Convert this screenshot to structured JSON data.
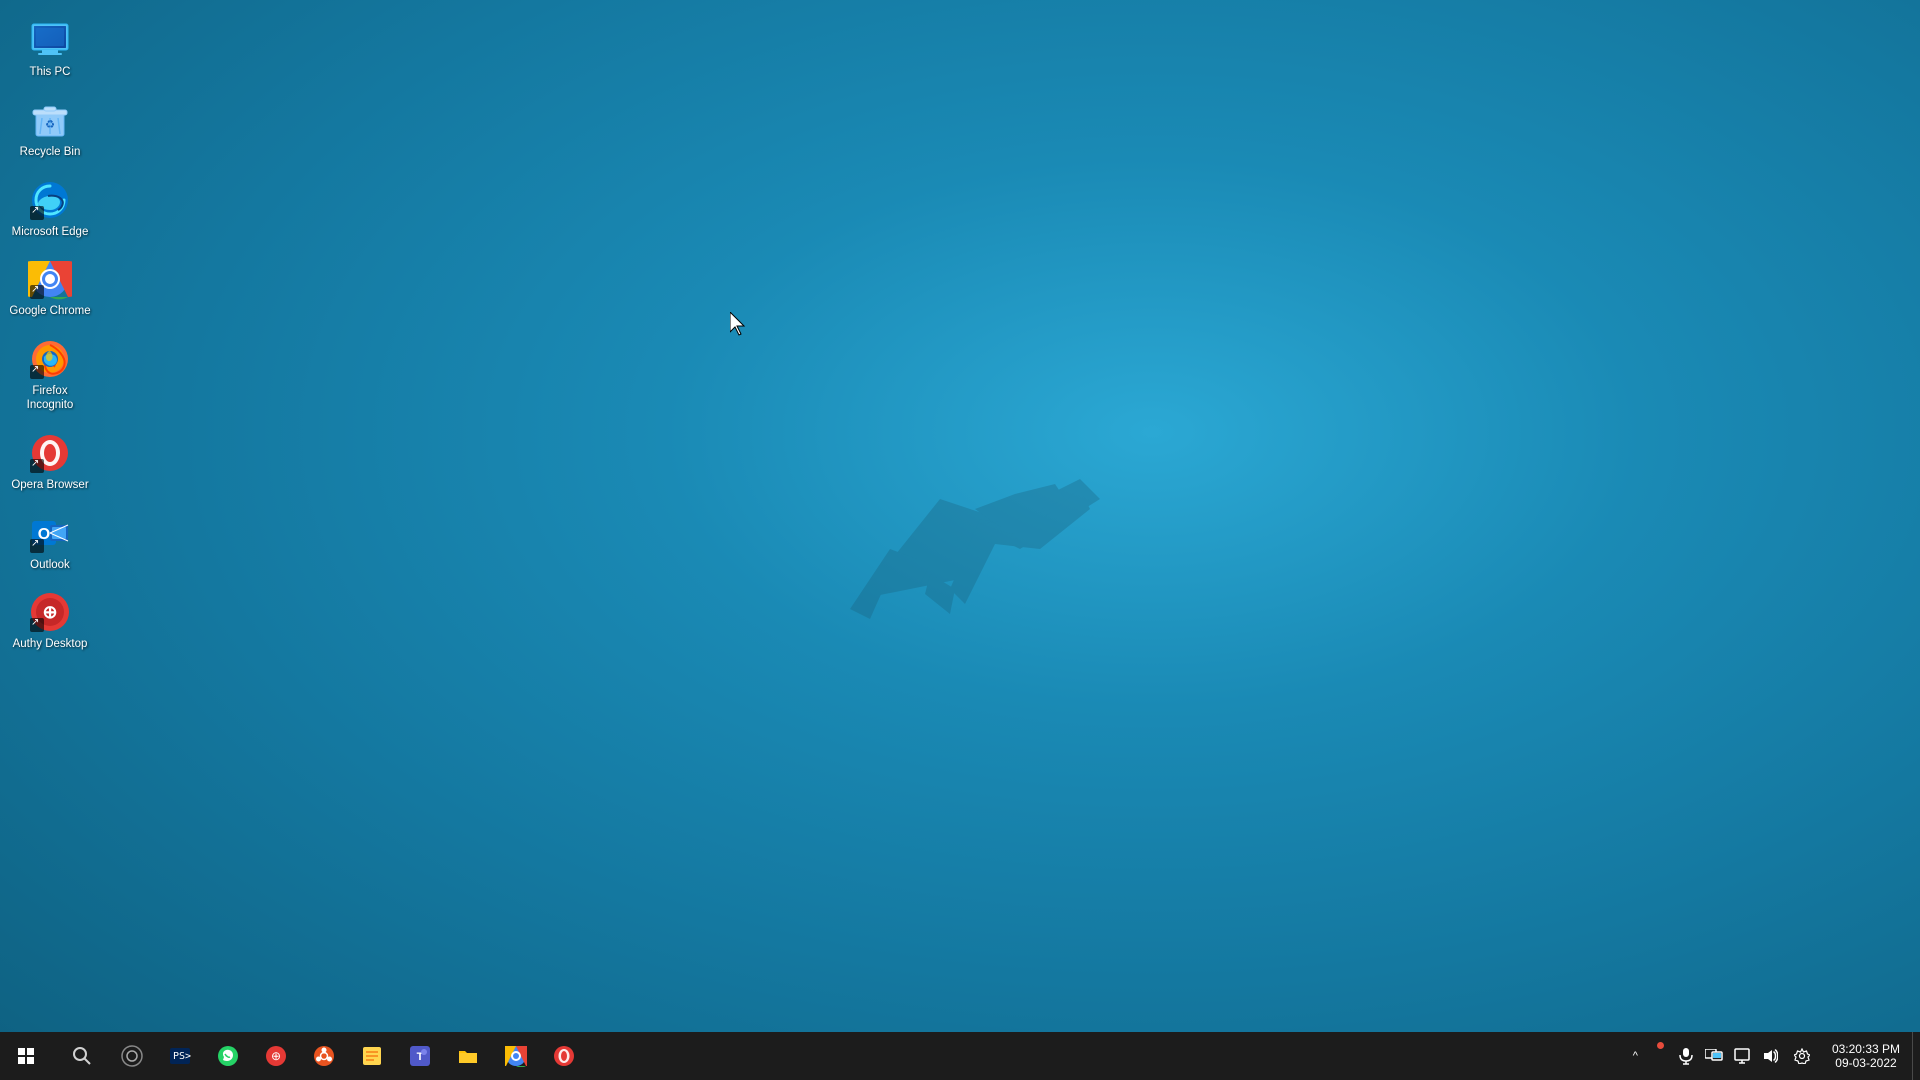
{
  "desktop": {
    "background_color_start": "#2ba8d4",
    "background_color_end": "#0e6080"
  },
  "icons": [
    {
      "id": "this-pc",
      "label": "This PC",
      "shortcut": false,
      "color": "#4fc3f7"
    },
    {
      "id": "recycle-bin",
      "label": "Recycle Bin",
      "shortcut": false,
      "color": "#90caf9"
    },
    {
      "id": "microsoft-edge",
      "label": "Microsoft Edge",
      "shortcut": true,
      "color": "#0078d4"
    },
    {
      "id": "google-chrome",
      "label": "Google Chrome",
      "shortcut": true,
      "color": "#4caf50"
    },
    {
      "id": "firefox-incognito",
      "label": "Firefox Incognito",
      "shortcut": true,
      "color": "#ff6b35"
    },
    {
      "id": "opera-browser",
      "label": "Opera Browser",
      "shortcut": true,
      "color": "#e53935"
    },
    {
      "id": "outlook",
      "label": "Outlook",
      "shortcut": true,
      "color": "#0078d4"
    },
    {
      "id": "authy-desktop",
      "label": "Authy Desktop",
      "shortcut": true,
      "color": "#e53935"
    }
  ],
  "taskbar": {
    "items": [
      {
        "id": "start",
        "label": "Start"
      },
      {
        "id": "search",
        "label": "Search"
      },
      {
        "id": "cortana",
        "label": "Cortana"
      },
      {
        "id": "terminal",
        "label": "Terminal"
      },
      {
        "id": "whatsapp",
        "label": "WhatsApp"
      },
      {
        "id": "authy",
        "label": "Authy"
      },
      {
        "id": "ubuntu",
        "label": "Ubuntu"
      },
      {
        "id": "sticky-notes",
        "label": "Sticky Notes"
      },
      {
        "id": "teams",
        "label": "Microsoft Teams"
      },
      {
        "id": "file-explorer",
        "label": "File Explorer"
      },
      {
        "id": "chrome-taskbar",
        "label": "Google Chrome"
      },
      {
        "id": "opera-taskbar",
        "label": "Opera Browser"
      }
    ],
    "tray": {
      "chevron": "^",
      "dot_visible": true,
      "time": "03:20:33 PM",
      "date": "09-03-2022"
    }
  }
}
